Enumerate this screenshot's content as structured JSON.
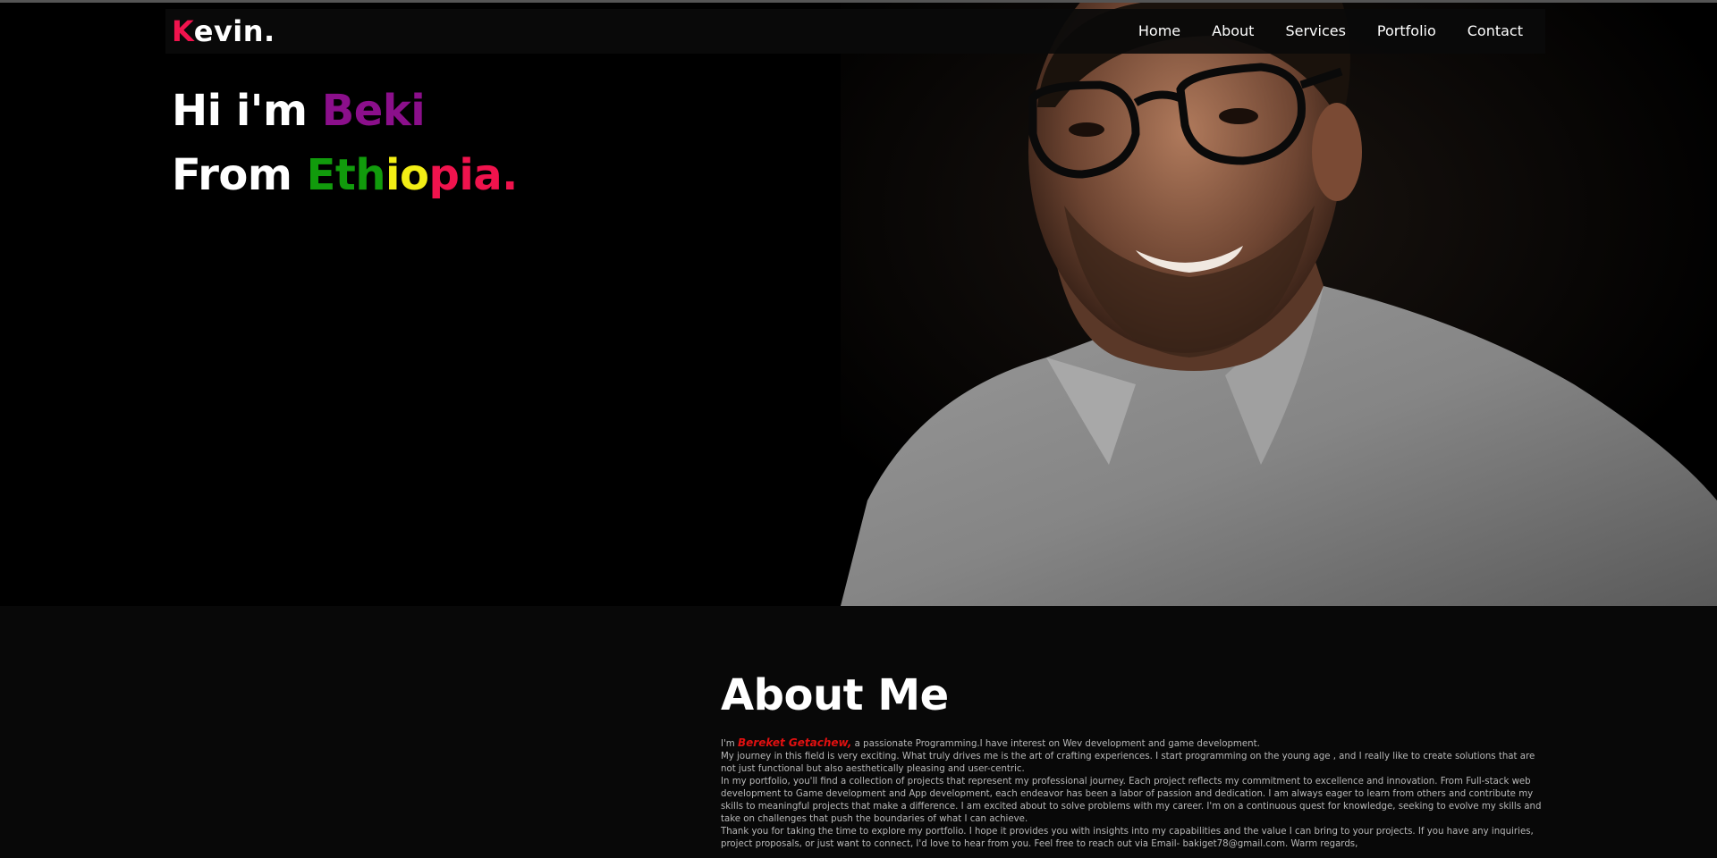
{
  "colors": {
    "accent_pink": "#f0134d",
    "accent_purple": "#8b0f8b",
    "ethiopia_green": "#119b0c",
    "ethiopia_yellow": "#f3ee15",
    "name_red": "#e01010",
    "background": "#000000",
    "section_background": "#080808"
  },
  "nav": {
    "logo_first": "K",
    "logo_rest": "evin.",
    "items": [
      {
        "label": "Home"
      },
      {
        "label": "About"
      },
      {
        "label": "Services"
      },
      {
        "label": "Portfolio"
      },
      {
        "label": "Contact"
      }
    ]
  },
  "hero": {
    "greeting_prefix": "Hi i'm",
    "greeting_name": "Beki",
    "from_prefix": "From",
    "country_parts": [
      "Eth",
      "i",
      "o",
      "pia."
    ],
    "photo": "portrait-photo"
  },
  "about": {
    "title": "About Me",
    "intro_prefix": "I'm",
    "name": "Bereket Getachew,",
    "intro_rest": " a passionate Programming.I have interest on Wev development and game development.",
    "paragraph_1": "My journey in this field is very exciting. What truly drives me is the art of crafting experiences. I start programming on the young age , and I really like to create solutions that are not just functional but also aesthetically pleasing and user-centric.",
    "paragraph_2": "In my portfolio, you'll find a collection of projects that represent my professional journey. Each project reflects my commitment to excellence and innovation. From Full-stack web development to Game development and App development, each endeavor has been a labor of passion and dedication. I am always eager to learn from others and contribute my skills to meaningful projects that make a difference. I am excited about to solve problems with my career. I'm on a continuous quest for knowledge, seeking to evolve my skills and take on challenges that push the boundaries of what I can achieve.",
    "paragraph_3": "Thank you for taking the time to explore my portfolio. I hope it provides you with insights into my capabilities and the value I can bring to your projects. If you have any inquiries, project proposals, or just want to connect, I'd love to hear from you. Feel free to reach out via Email- bakiget78@gmail.com. Warm regards,"
  }
}
